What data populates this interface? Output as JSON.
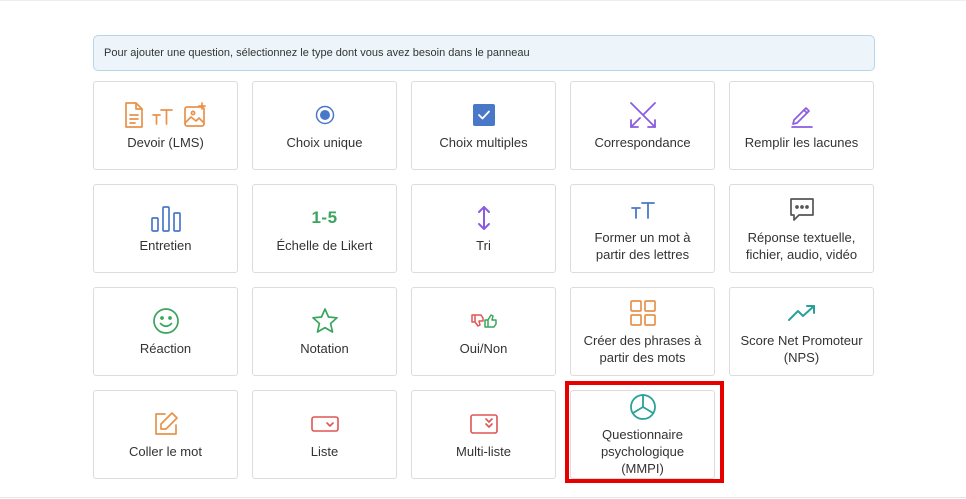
{
  "info_banner": {
    "text": "Pour ajouter une question, sélectionnez le type dont vous avez besoin dans le panneau"
  },
  "tiles": [
    {
      "label": "Devoir (LMS)",
      "icon": "assignment-icons",
      "color": "#e8924a"
    },
    {
      "label": "Choix unique",
      "icon": "radio-icon",
      "color": "#4a78c8"
    },
    {
      "label": "Choix multiples",
      "icon": "checkbox-icon",
      "color": "#4a78c8"
    },
    {
      "label": "Correspondance",
      "icon": "matching-arrows-icon",
      "color": "#8a5ce0"
    },
    {
      "label": "Remplir les lacunes",
      "icon": "pencil-icon",
      "color": "#8a5ce0"
    },
    {
      "label": "Entretien",
      "icon": "bar-chart-icon",
      "color": "#4a78c8"
    },
    {
      "label": "Échelle de Likert",
      "icon": "likert-scale-icon",
      "icon_text": "1-5",
      "color": "#3aa55c"
    },
    {
      "label": "Tri",
      "icon": "sort-arrows-icon",
      "color": "#8a5ce0"
    },
    {
      "label": "Former un mot à partir des lettres",
      "icon": "text-size-icon",
      "color": "#4a78c8"
    },
    {
      "label": "Réponse textuelle, fichier, audio, vidéo",
      "icon": "comment-icon",
      "color": "#555555"
    },
    {
      "label": "Réaction",
      "icon": "smile-icon",
      "color": "#3aa55c"
    },
    {
      "label": "Notation",
      "icon": "star-icon",
      "color": "#3aa55c"
    },
    {
      "label": "Oui/Non",
      "icon": "thumbs-icon",
      "color": "#e05555"
    },
    {
      "label": "Créer des phrases à partir des mots",
      "icon": "grid-icon",
      "color": "#e8924a"
    },
    {
      "label": "Score Net Promoteur (NPS)",
      "icon": "trending-up-icon",
      "color": "#2aa198"
    },
    {
      "label": "Coller le mot",
      "icon": "edit-box-icon",
      "color": "#e8924a"
    },
    {
      "label": "Liste",
      "icon": "dropdown-icon",
      "color": "#e05555"
    },
    {
      "label": "Multi-liste",
      "icon": "multi-dropdown-icon",
      "color": "#e05555"
    },
    {
      "label": "Questionnaire psychologique (MMPI)",
      "icon": "pie-chart-icon",
      "color": "#2aa198"
    }
  ],
  "highlight_color": "#e60000"
}
